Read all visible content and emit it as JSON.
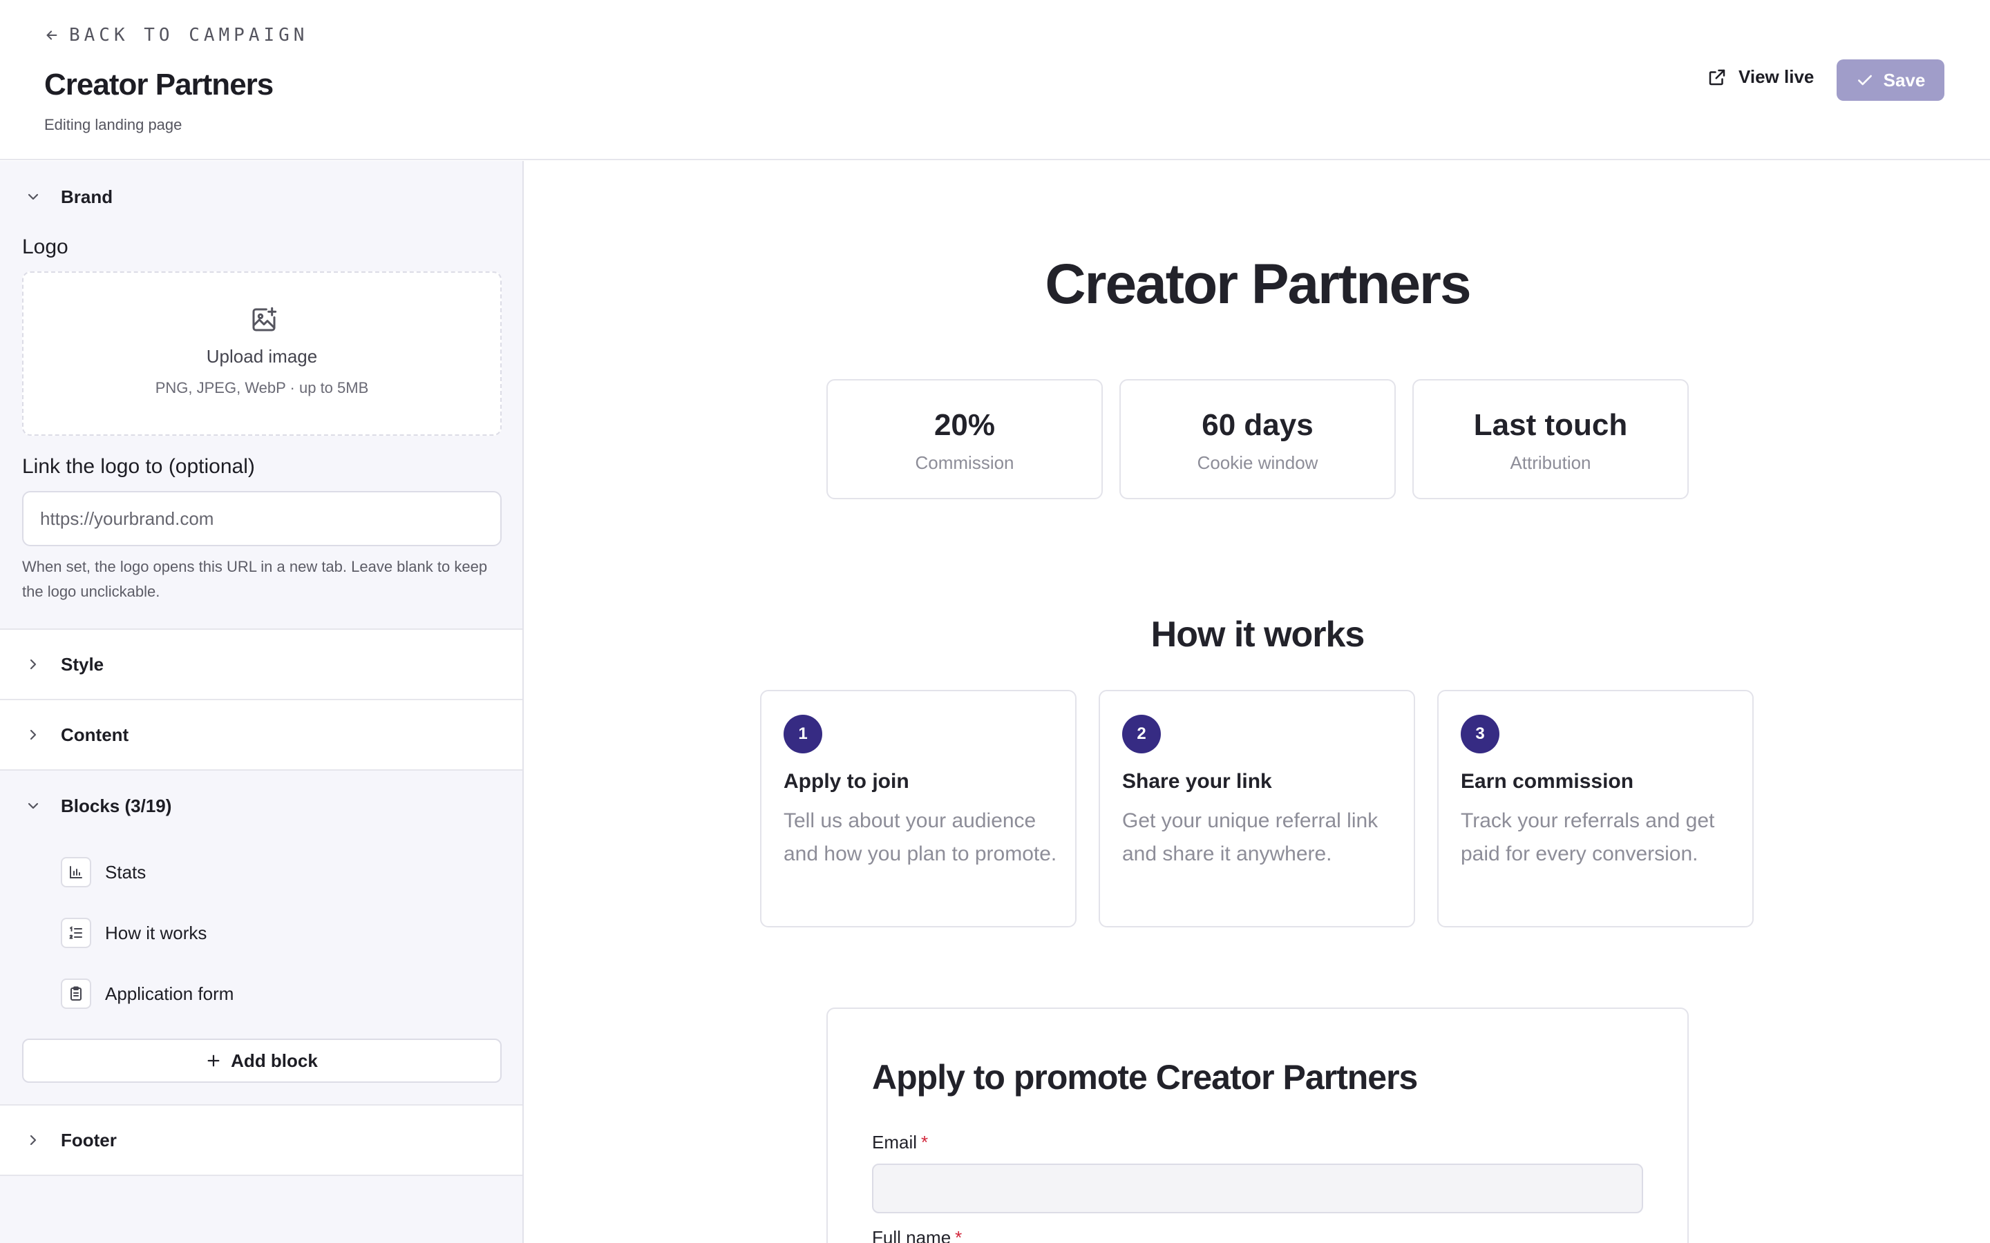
{
  "header": {
    "back_label": "BACK TO CAMPAIGN",
    "title": "Creator Partners",
    "subtitle": "Editing landing page",
    "view_live_label": "View live",
    "save_label": "Save"
  },
  "sidebar": {
    "brand": {
      "label": "Brand",
      "logo_label": "Logo",
      "upload_title": "Upload image",
      "upload_hint": "PNG, JPEG, WebP · up to 5MB",
      "link_label": "Link the logo to (optional)",
      "link_placeholder": "https://yourbrand.com",
      "link_value": "",
      "help_text": "When set, the logo opens this URL in a new tab. Leave blank to keep the logo unclickable."
    },
    "style_label": "Style",
    "content_label": "Content",
    "blocks": {
      "label": "Blocks (3/19)",
      "items": [
        {
          "label": "Stats",
          "icon": "bar-chart-icon"
        },
        {
          "label": "How it works",
          "icon": "list-ordered-icon"
        },
        {
          "label": "Application form",
          "icon": "clipboard-icon"
        }
      ],
      "add_label": "Add block"
    },
    "footer_label": "Footer"
  },
  "preview": {
    "title": "Creator Partners",
    "stats": [
      {
        "value": "20%",
        "label": "Commission"
      },
      {
        "value": "60 days",
        "label": "Cookie window"
      },
      {
        "value": "Last touch",
        "label": "Attribution"
      }
    ],
    "how_title": "How it works",
    "steps": [
      {
        "num": "1",
        "title": "Apply to join",
        "desc": "Tell us about your audience and how you plan to promote."
      },
      {
        "num": "2",
        "title": "Share your link",
        "desc": "Get your unique referral link and share it anywhere."
      },
      {
        "num": "3",
        "title": "Earn commission",
        "desc": "Track your referrals and get paid for every conversion."
      }
    ],
    "form": {
      "title": "Apply to promote Creator Partners",
      "email_label": "Email",
      "name_label": "Full name",
      "required_mark": "*"
    }
  },
  "colors": {
    "accent": "#362b83",
    "save_button": "#a09dc9",
    "required": "#d2263b",
    "sidebar_bg": "#f6f6fb"
  }
}
